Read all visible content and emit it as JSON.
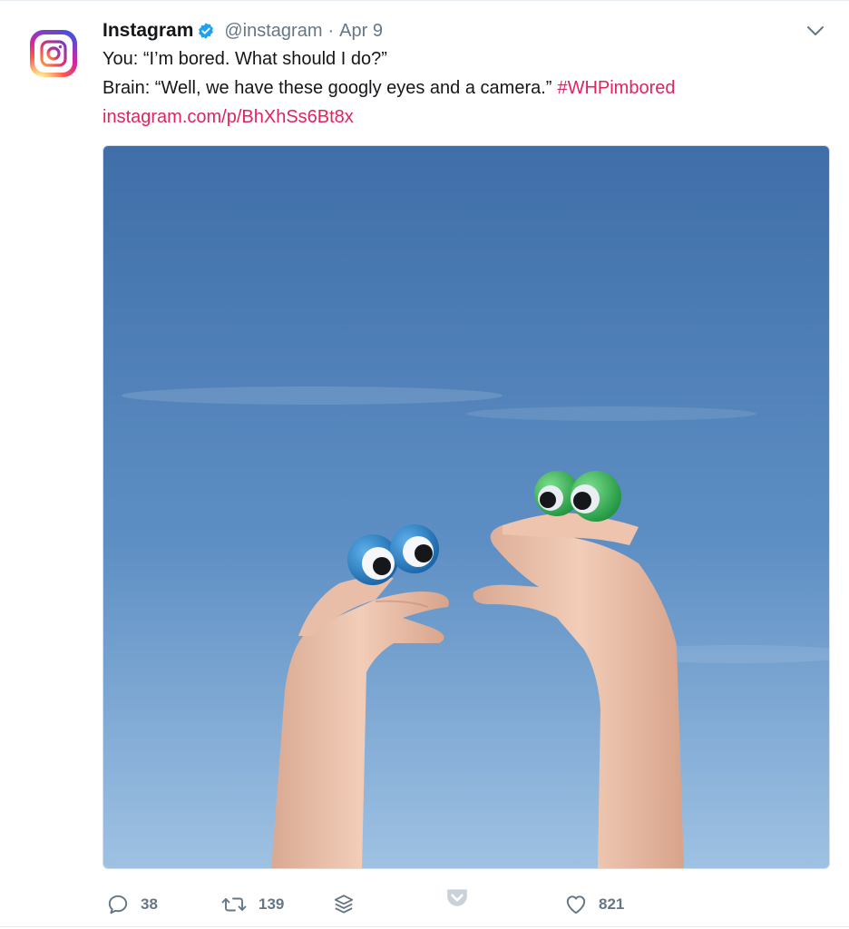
{
  "tweet": {
    "display_name": "Instagram",
    "handle": "@instagram",
    "separator": "·",
    "date": "Apr 9",
    "text_line1": "You: “I’m bored. What should I do?”",
    "text_line2": "Brain: “Well, we have these googly eyes and a camera.”",
    "hashtag": "#WHPimbored",
    "link": "instagram.com/p/BhXhSs6Bt8x"
  },
  "actions": {
    "reply_count": "38",
    "retweet_count": "139",
    "like_count": "821"
  },
  "icons": {
    "avatar": "instagram-logo-icon",
    "verified": "verified-badge-icon",
    "more": "chevron-down-icon",
    "reply": "reply-icon",
    "retweet": "retweet-icon",
    "buffer": "buffer-stack-icon",
    "pocket": "pocket-icon",
    "like": "heart-icon"
  },
  "colors": {
    "accent_link": "#e0245e",
    "muted_text": "#657786",
    "verified_blue": "#1da1f2",
    "sky_top": "#3f6ea8",
    "sky_bottom": "#9fc2e3"
  }
}
